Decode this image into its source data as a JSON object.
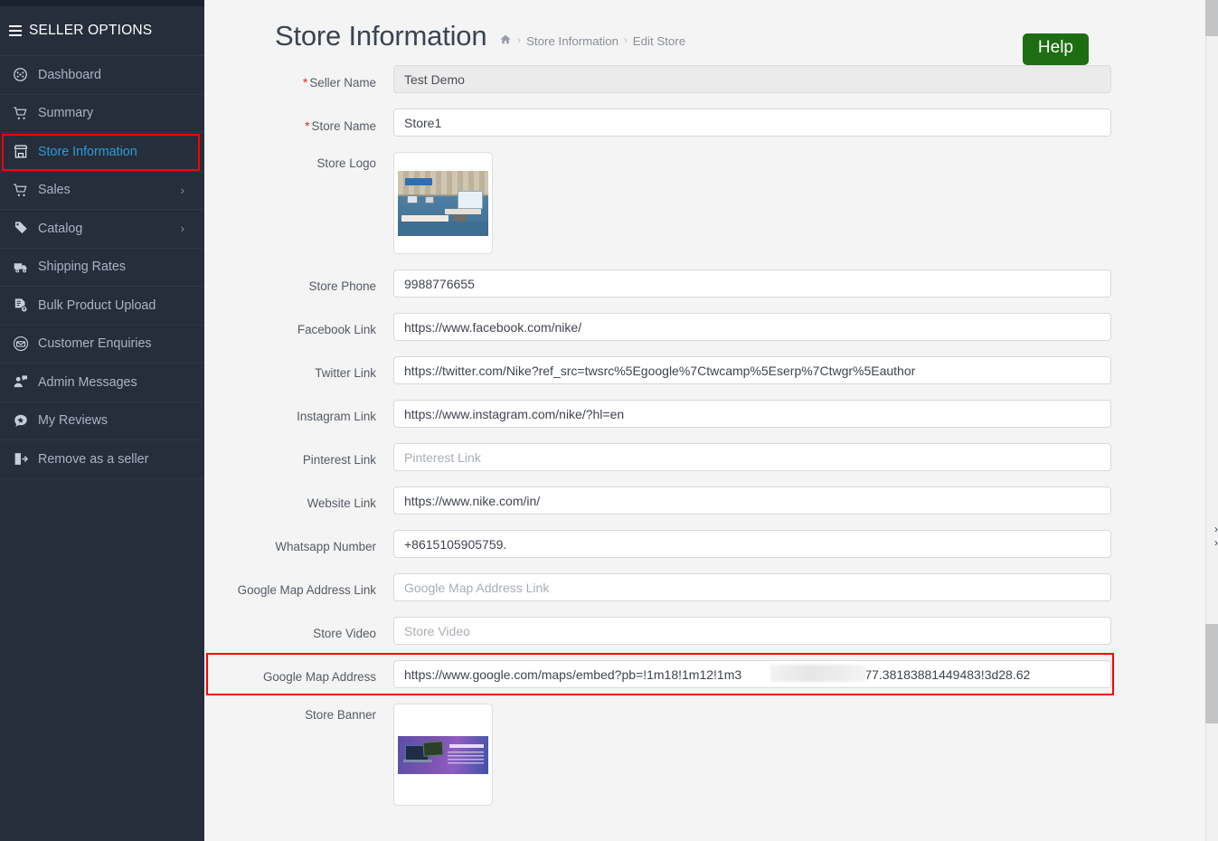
{
  "sidebar": {
    "header": "SELLER OPTIONS",
    "menu_icon": "hamburger-icon",
    "items": [
      {
        "label": "Dashboard",
        "icon": "dashboard-gauge-icon",
        "active": false,
        "chevron": ""
      },
      {
        "label": "Summary",
        "icon": "shopping-cart-icon",
        "active": false,
        "chevron": ""
      },
      {
        "label": "Store Information",
        "icon": "store-front-icon",
        "active": true,
        "chevron": ""
      },
      {
        "label": "Sales",
        "icon": "cart-icon",
        "active": false,
        "chevron": "›"
      },
      {
        "label": "Catalog",
        "icon": "tag-icon",
        "active": false,
        "chevron": "›"
      },
      {
        "label": "Shipping Rates",
        "icon": "truck-icon",
        "active": false,
        "chevron": ""
      },
      {
        "label": "Bulk Product Upload",
        "icon": "file-upload-icon",
        "active": false,
        "chevron": ""
      },
      {
        "label": "Customer Enquiries",
        "icon": "envelope-circle-icon",
        "active": false,
        "chevron": ""
      },
      {
        "label": "Admin Messages",
        "icon": "user-message-icon",
        "active": false,
        "chevron": ""
      },
      {
        "label": "My Reviews",
        "icon": "comment-star-icon",
        "active": false,
        "chevron": ""
      },
      {
        "label": "Remove as a seller",
        "icon": "sign-out-icon",
        "active": false,
        "chevron": ""
      }
    ]
  },
  "header": {
    "title": "Store Information",
    "home_icon": "home-icon",
    "breadcrumb": [
      {
        "label": "Store Information",
        "link": true
      },
      {
        "label": "Edit Store",
        "link": false
      }
    ],
    "separator": "›",
    "help_label": "Help"
  },
  "form": {
    "fields": [
      {
        "name": "seller-name",
        "label": "Seller Name",
        "required": true,
        "type": "text",
        "value": "Test Demo",
        "placeholder": "",
        "readonly": true
      },
      {
        "name": "store-name",
        "label": "Store Name",
        "required": true,
        "type": "text",
        "value": "Store1",
        "placeholder": "",
        "readonly": false
      },
      {
        "name": "store-logo",
        "label": "Store Logo",
        "required": false,
        "type": "image",
        "value": "",
        "placeholder": "",
        "readonly": false
      },
      {
        "name": "store-phone",
        "label": "Store Phone",
        "required": false,
        "type": "text",
        "value": "9988776655",
        "placeholder": "Store Phone",
        "readonly": false
      },
      {
        "name": "facebook-link",
        "label": "Facebook Link",
        "required": false,
        "type": "text",
        "value": "https://www.facebook.com/nike/",
        "placeholder": "Facebook Link",
        "readonly": false
      },
      {
        "name": "twitter-link",
        "label": "Twitter Link",
        "required": false,
        "type": "text",
        "value": "https://twitter.com/Nike?ref_src=twsrc%5Egoogle%7Ctwcamp%5Eserp%7Ctwgr%5Eauthor",
        "placeholder": "Twitter Link",
        "readonly": false
      },
      {
        "name": "instagram-link",
        "label": "Instagram Link",
        "required": false,
        "type": "text",
        "value": "https://www.instagram.com/nike/?hl=en",
        "placeholder": "Instagram Link",
        "readonly": false
      },
      {
        "name": "pinterest-link",
        "label": "Pinterest Link",
        "required": false,
        "type": "text",
        "value": "",
        "placeholder": "Pinterest Link",
        "readonly": false
      },
      {
        "name": "website-link",
        "label": "Website Link",
        "required": false,
        "type": "text",
        "value": "https://www.nike.com/in/",
        "placeholder": "Website Link",
        "readonly": false
      },
      {
        "name": "whatsapp-number",
        "label": "Whatsapp Number",
        "required": false,
        "type": "text",
        "value": "+8615105905759.",
        "placeholder": "Whatsapp Number",
        "readonly": false
      },
      {
        "name": "google-map-address-link",
        "label": "Google Map Address Link",
        "required": false,
        "type": "text",
        "value": "",
        "placeholder": "Google Map Address Link",
        "readonly": false
      },
      {
        "name": "store-video",
        "label": "Store Video",
        "required": false,
        "type": "text",
        "value": "",
        "placeholder": "Store Video",
        "readonly": false
      },
      {
        "name": "google-map-address",
        "label": "Google Map Address",
        "required": false,
        "type": "text",
        "value": "https://www.google.com/maps/embed?pb=!1m18!1m12!1m3                    58055!2d77.38183881449483!3d28.62",
        "placeholder": "Google Map Address",
        "readonly": false,
        "highlighted": true,
        "redacted": true
      },
      {
        "name": "store-banner",
        "label": "Store Banner",
        "required": false,
        "type": "image",
        "value": "",
        "placeholder": "",
        "readonly": false
      }
    ]
  },
  "colors": {
    "sidebar_bg": "#262e3c",
    "active_link": "#2e9bd6",
    "highlight_border": "#ff0000",
    "help_green": "#1d6e12",
    "required_red": "#e02727",
    "page_bg": "#f4f4f4"
  }
}
